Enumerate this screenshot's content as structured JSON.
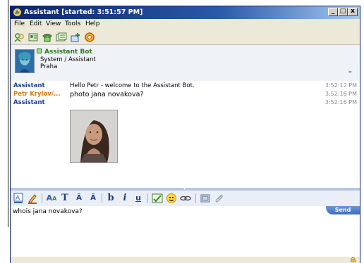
{
  "window": {
    "title": "Assistant [started: 3:51:57 PM]",
    "controls": [
      "_",
      "□",
      "x"
    ]
  },
  "menu": [
    "File",
    "Edit",
    "View",
    "Tools",
    "Help"
  ],
  "toolbar": {
    "icons": [
      "users-icon",
      "contacts-icon",
      "phone-icon",
      "card-icon",
      "add-contact-icon",
      "block-icon"
    ]
  },
  "contact": {
    "name": "Assistant Bot",
    "line2": "System / Assistant",
    "line3": "Praha",
    "status_color": "#2d7d1a"
  },
  "messages": [
    {
      "sender": "Assistant",
      "sender_color": "#1c3f8c",
      "text": "Hello Petr - welcome to the Assistant Bot.",
      "time": "3:52:12 PM"
    },
    {
      "sender": "Petr Krylov/...",
      "sender_color": "#d67a13",
      "text": "photo jana novakova?",
      "time": "3:52:16 PM"
    },
    {
      "sender": "Assistant",
      "sender_color": "#1c3f8c",
      "text": "",
      "time": "3:52:16 PM"
    }
  ],
  "format_toolbar": {
    "items": [
      "font-color-icon",
      "pen-icon",
      "font-icon",
      "T",
      "grow-font-icon",
      "shrink-font-icon",
      "b",
      "i",
      "u",
      "spellcheck-icon",
      "emoticon-icon",
      "link-icon",
      "screenshot-icon",
      "attach-icon"
    ]
  },
  "input": {
    "value": "whois jana novakova?",
    "send_label": "Send"
  },
  "colors": {
    "titlebar": "#0a246a",
    "accent": "#3d6cbf"
  }
}
